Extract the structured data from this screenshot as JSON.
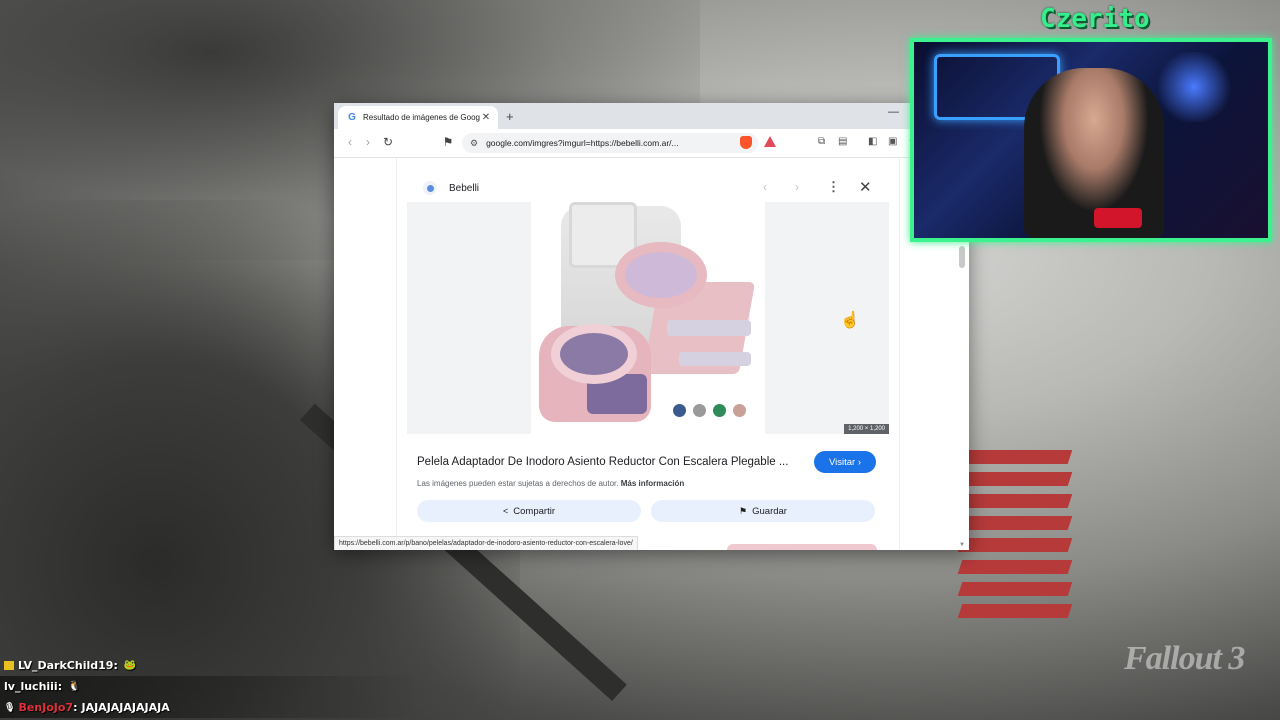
{
  "browser": {
    "tab_title": "Resultado de imágenes de Google",
    "tab_close": "✕",
    "new_tab": "+",
    "url": "google.com/imgres?imgurl=https://bebelli.com.ar/...",
    "status_url": "https://bebelli.com.ar/p/bano/pelelas/adaptador-de-inodoro-asiento-reductor-con-escalera-love/"
  },
  "panel": {
    "site_name": "Bebelli",
    "image_dims": "1,200 × 1,200",
    "title": "Pelela Adaptador De Inodoro Asiento Reductor Con Escalera Plegable ...",
    "visit_label": "Visitar",
    "copyright_text": "Las imágenes pueden estar sujetas a derechos de autor.",
    "more_info": "Más información",
    "share_label": "Compartir",
    "save_label": "Guardar",
    "swatch_colors": [
      "#3b5a8e",
      "#9a9a9a",
      "#2e8b5a",
      "#c8a098"
    ]
  },
  "stream": {
    "streamer_name": "Czerito",
    "game_logo": "Fallout 3"
  },
  "chat": [
    {
      "user": "LV_DarkChild19",
      "sep": " :",
      "message": "",
      "user_color": "#ffffff"
    },
    {
      "user": "lv_luchiii",
      "sep": " :",
      "message": "",
      "user_color": "#ffffff"
    },
    {
      "user": "BenJoJo7",
      "sep": " :",
      "message": "JAJAJAJAJAJAJA",
      "user_color": "#e0303a"
    }
  ],
  "icons": {
    "back": "back-arrow-icon",
    "forward": "forward-arrow-icon",
    "reload": "reload-icon",
    "bookmark": "bookmark-icon",
    "close": "close-icon",
    "more": "more-vert-icon"
  }
}
